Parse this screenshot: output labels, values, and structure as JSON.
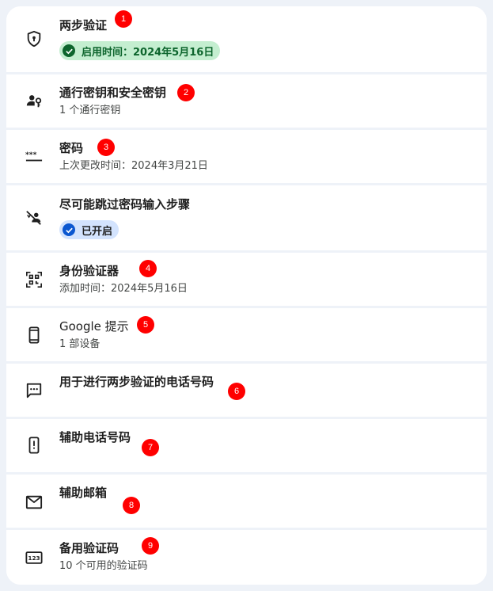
{
  "colors": {
    "page_bg": "#eef2f8",
    "badge_green_bg": "#c4eed0",
    "badge_green_fg": "#0d652d",
    "badge_blue_bg": "#d3e3fd",
    "badge_blue_fg": "#0b57d0",
    "marker": "#ff0000"
  },
  "items": [
    {
      "icon": "shield-lock-icon",
      "title": "两步验证",
      "badge": "启用时间：2024年5月16日",
      "marker": "1"
    },
    {
      "icon": "person-key-icon",
      "title": "通行密钥和安全密钥",
      "subtitle": "1 个通行密钥",
      "marker": "2"
    },
    {
      "icon": "password-icon",
      "title": "密码",
      "subtitle": "上次更改时间：2024年3月21日",
      "marker": "3"
    },
    {
      "icon": "password-off-icon",
      "title": "尽可能跳过密码输入步骤",
      "badge": "已开启"
    },
    {
      "icon": "qr-code-scanner-icon",
      "title": "身份验证器",
      "subtitle": "添加时间：2024年5月16日",
      "marker": "4"
    },
    {
      "icon": "smartphone-icon",
      "title": "Google 提示",
      "subtitle": "1 部设备",
      "marker": "5"
    },
    {
      "icon": "message-icon",
      "title": "用于进行两步验证的电话号码",
      "marker": "6"
    },
    {
      "icon": "phone-alert-icon",
      "title": "辅助电话号码",
      "marker": "7"
    },
    {
      "icon": "mail-icon",
      "title": "辅助邮箱",
      "marker": "8"
    },
    {
      "icon": "backup-codes-icon",
      "title": "备用验证码",
      "subtitle": "10 个可用的验证码",
      "marker": "9"
    }
  ]
}
